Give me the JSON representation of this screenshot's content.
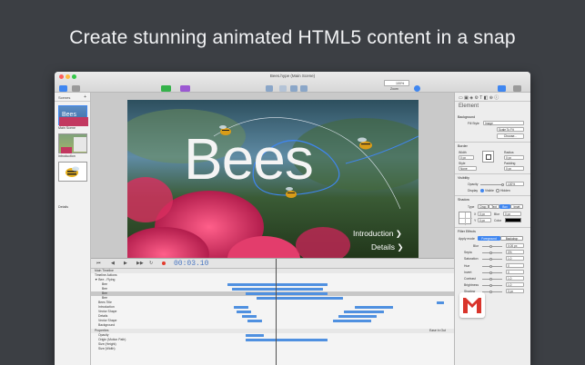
{
  "headline": "Create stunning animated HTML5 content in a snap",
  "window": {
    "title": "Bees.hype (Main Scene)",
    "traffic_colors": [
      "#fc605c",
      "#fdbc40",
      "#34c84a"
    ]
  },
  "toolbar": {
    "scenes_label": "Scenes",
    "layouts_label": "Layouts",
    "elements_label": "Elements",
    "symbols_label": "Symbols",
    "group_label": "Group",
    "ungroup_label": "Ungroup",
    "front_label": "Front",
    "back_label": "Back",
    "zoom_value": "100%",
    "zoom_label": "Zoom",
    "preview_label": "Preview",
    "inspector_label": "Inspector",
    "library_label": "Library"
  },
  "scenes_panel": {
    "header": "Scenes",
    "items": [
      "Main Scene",
      "Introduction",
      "Details"
    ]
  },
  "stage": {
    "title_text": "Bees",
    "link_intro": "Introduction ❯",
    "link_details": "Details ❯"
  },
  "timeline": {
    "time": "00:03.10",
    "header": "Main Timeline",
    "rows": [
      {
        "name": "Timeline Actions",
        "bar": null
      },
      {
        "name": "▼ Bee - Flying",
        "bar": null
      },
      {
        "name": "Bee",
        "bar": [
          190,
          300
        ]
      },
      {
        "name": "Bee",
        "bar": [
          195,
          292
        ]
      },
      {
        "name": "Bee",
        "bar": [
          210,
          290
        ],
        "selected": true
      },
      {
        "name": "Bee",
        "bar": [
          222,
          300
        ]
      },
      {
        "name": "Bees Title",
        "bar": [
          420,
          430
        ]
      },
      {
        "name": "Introduction",
        "bar": [
          197,
          213
        ]
      },
      {
        "name": "Vector Shape",
        "bar": [
          200,
          216
        ]
      },
      {
        "name": "Details",
        "bar": [
          206,
          222
        ]
      },
      {
        "name": "Vector Shape",
        "bar": [
          212,
          228
        ]
      },
      {
        "name": "Background",
        "bar": null
      }
    ],
    "bars_right": [
      {
        "row": 7,
        "from": 330,
        "to": 372
      },
      {
        "row": 8,
        "from": 318,
        "to": 362
      },
      {
        "row": 9,
        "from": 312,
        "to": 354
      },
      {
        "row": 10,
        "from": 306,
        "to": 348
      }
    ],
    "properties_header": "Properties",
    "properties": [
      "Opacity",
      "Origin (Motion Path)",
      "Size (Height)",
      "Size (Width)"
    ],
    "ease_label": "Ease In Out"
  },
  "inspector": {
    "title": "Element",
    "background_header": "Background",
    "fill_style_label": "Fill Style",
    "fill_style_value": "Image",
    "scale_value": "Scale To Fit",
    "choose_label": "Choose...",
    "border_header": "Border",
    "width_label": "Width",
    "width_value": "0 px",
    "style_label": "Style",
    "style_value": "None",
    "radius_label": "Radius",
    "radius_value": "0 px",
    "padding_label": "Padding",
    "padding_value": "0 px",
    "visibility_header": "Visibility",
    "opacity_label": "Opacity",
    "opacity_value": "100%",
    "display_label": "Display",
    "visible_label": "Visible",
    "hidden_label": "Hidden",
    "shadow_header": "Shadow",
    "type_label": "Type",
    "drop_label": "Drop",
    "text_label": "Text",
    "box_label": "Box",
    "inset_label": "Inset",
    "x_label": "X",
    "x_value": "0 px",
    "y_label": "Y",
    "y_value": "0 px",
    "blur_label": "Blur",
    "blur_value": "0 px",
    "color_label": "Color",
    "filter_header": "Filter Effects",
    "apply_label": "Apply mode",
    "foreground_label": "Foreground",
    "backdrop_label": "Backdrop",
    "filters": [
      {
        "label": "Blur",
        "value": "0.00 px"
      },
      {
        "label": "Sepia",
        "value": "0%"
      },
      {
        "label": "Saturation",
        "value": "1.0"
      },
      {
        "label": "Hue",
        "value": "0"
      },
      {
        "label": "Invert",
        "value": "0"
      },
      {
        "label": "Contrast",
        "value": "1.0"
      },
      {
        "label": "Brightness",
        "value": "1.0"
      },
      {
        "label": "Shadow",
        "value": "0 px"
      }
    ],
    "accent": "#3f86f0"
  }
}
